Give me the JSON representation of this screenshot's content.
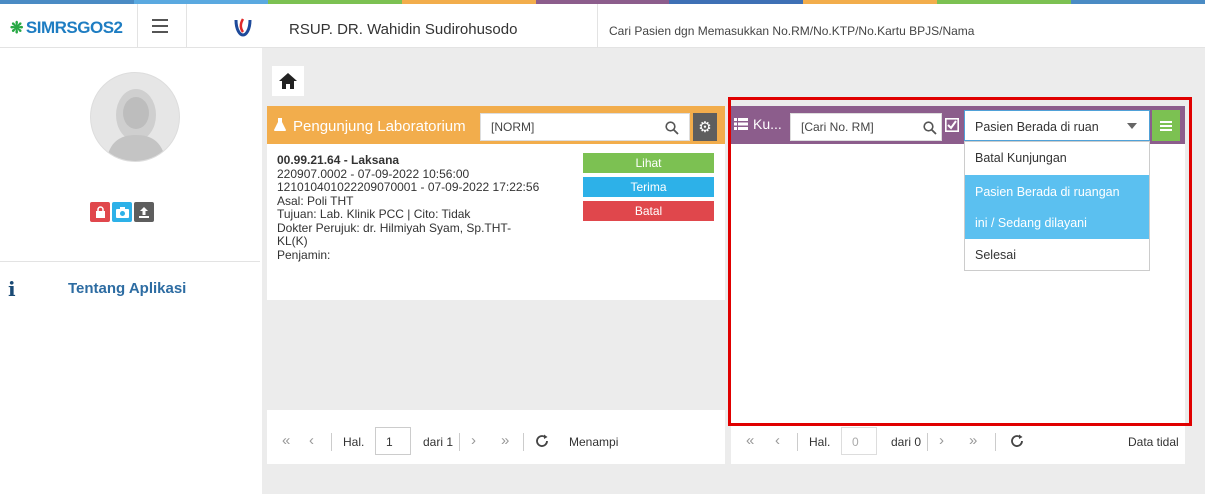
{
  "colorbar": [
    "#4a8bc4",
    "#5aa9e0",
    "#7cc152",
    "#f2ad4c",
    "#8c5d8c",
    "#3e70b5",
    "#f2ad4c",
    "#7cc152",
    "#4a8bc4"
  ],
  "header": {
    "logo_text": "SIMRSGOS2",
    "hospital": "RSUP. DR. Wahidin Sudirohusodo",
    "search_placeholder": "Cari Pasien dgn Memasukkan No.RM/No.KTP/No.Kartu BPJS/Nama"
  },
  "sidebar": {
    "about": "Tentang Aplikasi"
  },
  "panel1": {
    "title": "Pengunjung Laboratorium",
    "search_value": "[NORM]",
    "entry": {
      "line1": "00.99.21.64 - Laksana",
      "line2": "220907.0002 - 07-09-2022 10:56:00",
      "line3": "121010401022209070001 - 07-09-2022 17:22:56",
      "line4": "Asal: Poli THT",
      "line5": "Tujuan: Lab. Klinik PCC | Cito: Tidak",
      "line6": "Dokter Perujuk: dr. Hilmiyah Syam, Sp.THT-",
      "line7": "KL(K)",
      "line8": "Penjamin:"
    },
    "buttons": {
      "lihat": "Lihat",
      "terima": "Terima",
      "batal": "Batal"
    },
    "pager": {
      "hal": "Hal.",
      "page": "1",
      "of": "dari 1",
      "display": "Menampi"
    }
  },
  "panel2": {
    "title": "Ku...",
    "search_placeholder": "[Cari No. RM]",
    "select_value": "Pasien Berada di ruan",
    "options": [
      "Batal Kunjungan",
      "Pasien Berada di ruangan",
      "ini / Sedang dilayani",
      "Selesai"
    ],
    "pager": {
      "hal": "Hal.",
      "page": "0",
      "of": "dari 0",
      "display": "Data tidal"
    }
  },
  "colors": {
    "orange": "#f2ad4c",
    "purple": "#8c5d8c",
    "green": "#7cc152",
    "blue": "#2db1e8",
    "red": "#e0474c",
    "highlight": "#5bc0f0"
  }
}
